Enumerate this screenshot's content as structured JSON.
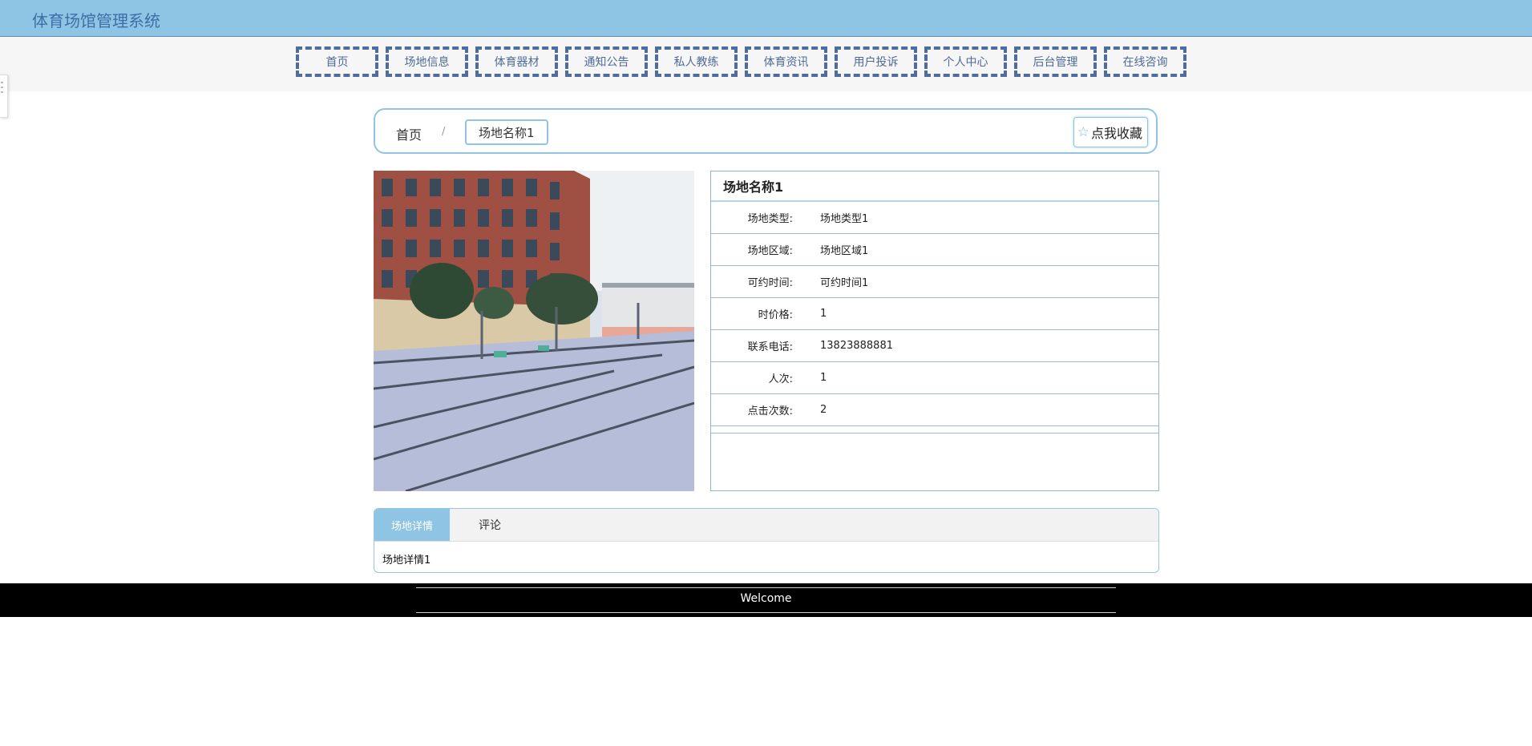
{
  "header": {
    "title": "体育场馆管理系统"
  },
  "nav": {
    "items": [
      {
        "label": "首页"
      },
      {
        "label": "场地信息"
      },
      {
        "label": "体育器材"
      },
      {
        "label": "通知公告"
      },
      {
        "label": "私人教练"
      },
      {
        "label": "体育资讯"
      },
      {
        "label": "用户投诉"
      },
      {
        "label": "个人中心"
      },
      {
        "label": "后台管理"
      },
      {
        "label": "在线咨询"
      }
    ]
  },
  "breadcrumb": {
    "home": "首页",
    "separator": "/",
    "current": "场地名称1"
  },
  "favorite": {
    "label": "点我收藏",
    "icon": "star-outline-icon"
  },
  "venue": {
    "name": "场地名称1",
    "fields": [
      {
        "label": "场地类型:",
        "value": "场地类型1"
      },
      {
        "label": "场地区域:",
        "value": "场地区域1"
      },
      {
        "label": "可约时间:",
        "value": "可约时间1"
      },
      {
        "label": "时价格:",
        "value": "1"
      },
      {
        "label": "联系电话:",
        "value": "13823888881"
      },
      {
        "label": "人次:",
        "value": "1"
      },
      {
        "label": "点击次数:",
        "value": "2"
      }
    ]
  },
  "tabs": {
    "items": [
      {
        "label": "场地详情"
      },
      {
        "label": "评论"
      }
    ],
    "content": "场地详情1"
  },
  "footer": {
    "text": "Welcome"
  },
  "colors": {
    "accent": "#8fc5e4",
    "nav_border": "#4f6c9f",
    "footer_bg": "#000000"
  }
}
